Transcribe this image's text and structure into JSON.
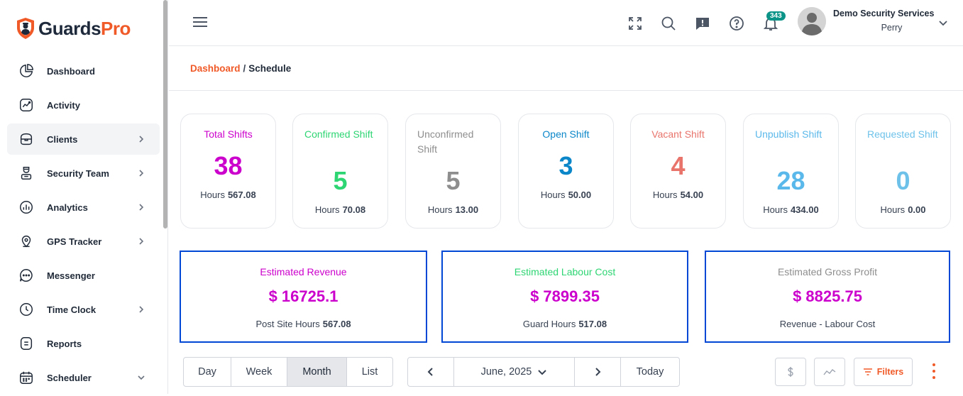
{
  "brand": {
    "name_part1": "Guards",
    "name_part2": "Pro"
  },
  "sidebar": {
    "items": [
      {
        "label": "Dashboard",
        "icon": "pie-chart-icon",
        "chevron": false,
        "active": false
      },
      {
        "label": "Activity",
        "icon": "activity-chart-icon",
        "chevron": false,
        "active": false
      },
      {
        "label": "Clients",
        "icon": "clients-box-icon",
        "chevron": "right",
        "active": true
      },
      {
        "label": "Security Team",
        "icon": "guard-person-icon",
        "chevron": "right",
        "active": false
      },
      {
        "label": "Analytics",
        "icon": "analytics-bars-icon",
        "chevron": "right",
        "active": false
      },
      {
        "label": "GPS Tracker",
        "icon": "map-pin-icon",
        "chevron": "right",
        "active": false
      },
      {
        "label": "Messenger",
        "icon": "chat-bubble-icon",
        "chevron": false,
        "active": false
      },
      {
        "label": "Time Clock",
        "icon": "clock-icon",
        "chevron": "right",
        "active": false
      },
      {
        "label": "Reports",
        "icon": "report-document-icon",
        "chevron": false,
        "active": false
      },
      {
        "label": "Scheduler",
        "icon": "calendar-icon",
        "chevron": "down",
        "active": false
      }
    ]
  },
  "header": {
    "notification_count": "343",
    "user": {
      "org": "Demo Security Services",
      "name": "Perry"
    }
  },
  "breadcrumb": {
    "parent": "Dashboard",
    "separator": "/",
    "current": "Schedule"
  },
  "stats": [
    {
      "title": "Total Shifts",
      "value": "38",
      "hours_label": "Hours",
      "hours": "567.08",
      "color": "#cc00cc"
    },
    {
      "title": "Confirmed Shift",
      "value": "5",
      "hours_label": "Hours",
      "hours": "70.08",
      "color": "#2ed573"
    },
    {
      "title": "Unconfirmed Shift",
      "value": "5",
      "hours_label": "Hours",
      "hours": "13.00",
      "color": "#8e8e8e"
    },
    {
      "title": "Open Shift",
      "value": "3",
      "hours_label": "Hours",
      "hours": "50.00",
      "color": "#0a86c9"
    },
    {
      "title": "Vacant Shift",
      "value": "4",
      "hours_label": "Hours",
      "hours": "54.00",
      "color": "#e8746c"
    },
    {
      "title": "Unpublish Shift",
      "value": "28",
      "hours_label": "Hours",
      "hours": "434.00",
      "color": "#5ab8ea"
    },
    {
      "title": "Requested Shift",
      "value": "0",
      "hours_label": "Hours",
      "hours": "0.00",
      "color": "#6ec2ea"
    }
  ],
  "estimates": [
    {
      "title": "Estimated Revenue",
      "value": "$ 16725.1",
      "sub_label": "Post Site Hours",
      "sub_value": "567.08",
      "title_color": "#cc00cc"
    },
    {
      "title": "Estimated Labour Cost",
      "value": "$ 7899.35",
      "sub_label": "Guard Hours",
      "sub_value": "517.08",
      "title_color": "#2ed573"
    },
    {
      "title": "Estimated Gross Profit",
      "value": "$ 8825.75",
      "sub_label": "Revenue - Labour Cost",
      "sub_value": "",
      "title_color": "#8e8e8e"
    }
  ],
  "view_tabs": [
    "Day",
    "Week",
    "Month",
    "List"
  ],
  "active_view": "Month",
  "date_nav": {
    "current": "June, 2025",
    "today_label": "Today"
  },
  "toolbar": {
    "filters_label": "Filters"
  }
}
